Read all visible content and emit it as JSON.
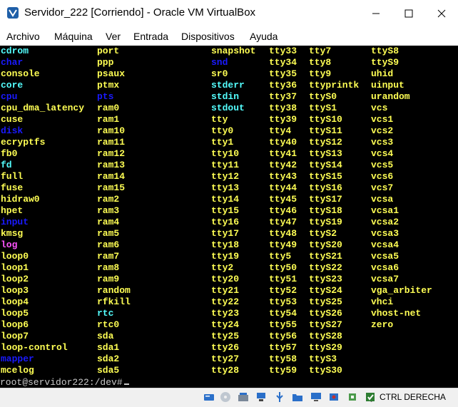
{
  "window": {
    "title": "Servidor_222 [Corriendo] - Oracle VM VirtualBox",
    "icons": [
      "virtualbox-icon",
      "minimize-icon",
      "maximize-icon",
      "close-icon"
    ]
  },
  "menu": [
    "Archivo",
    "Máquina",
    "Ver",
    "Entrada",
    "Dispositivos",
    "Ayuda"
  ],
  "colors": {
    "yellow": "#ffff54",
    "cyan": "#54ffff",
    "blue": "#1a1aff",
    "magenta": "#ff54ff"
  },
  "console": {
    "columns": [
      [
        {
          "t": "cdrom",
          "c": "cyan"
        },
        {
          "t": "char",
          "c": "blue"
        },
        {
          "t": "console",
          "c": "yellow"
        },
        {
          "t": "core",
          "c": "cyan"
        },
        {
          "t": "cpu",
          "c": "blue"
        },
        {
          "t": "cpu_dma_latency",
          "c": "yellow"
        },
        {
          "t": "cuse",
          "c": "yellow"
        },
        {
          "t": "disk",
          "c": "blue"
        },
        {
          "t": "ecryptfs",
          "c": "yellow"
        },
        {
          "t": "fb0",
          "c": "yellow"
        },
        {
          "t": "fd",
          "c": "cyan"
        },
        {
          "t": "full",
          "c": "yellow"
        },
        {
          "t": "fuse",
          "c": "yellow"
        },
        {
          "t": "hidraw0",
          "c": "yellow"
        },
        {
          "t": "hpet",
          "c": "yellow"
        },
        {
          "t": "input",
          "c": "blue"
        },
        {
          "t": "kmsg",
          "c": "yellow"
        },
        {
          "t": "log",
          "c": "magenta"
        },
        {
          "t": "loop0",
          "c": "yellow"
        },
        {
          "t": "loop1",
          "c": "yellow"
        },
        {
          "t": "loop2",
          "c": "yellow"
        },
        {
          "t": "loop3",
          "c": "yellow"
        },
        {
          "t": "loop4",
          "c": "yellow"
        },
        {
          "t": "loop5",
          "c": "yellow"
        },
        {
          "t": "loop6",
          "c": "yellow"
        },
        {
          "t": "loop7",
          "c": "yellow"
        },
        {
          "t": "loop-control",
          "c": "yellow"
        },
        {
          "t": "mapper",
          "c": "blue"
        },
        {
          "t": "mcelog",
          "c": "yellow"
        }
      ],
      [
        {
          "t": "port",
          "c": "yellow"
        },
        {
          "t": "ppp",
          "c": "yellow"
        },
        {
          "t": "psaux",
          "c": "yellow"
        },
        {
          "t": "ptmx",
          "c": "yellow"
        },
        {
          "t": "pts",
          "c": "blue"
        },
        {
          "t": "ram0",
          "c": "yellow"
        },
        {
          "t": "ram1",
          "c": "yellow"
        },
        {
          "t": "ram10",
          "c": "yellow"
        },
        {
          "t": "ram11",
          "c": "yellow"
        },
        {
          "t": "ram12",
          "c": "yellow"
        },
        {
          "t": "ram13",
          "c": "yellow"
        },
        {
          "t": "ram14",
          "c": "yellow"
        },
        {
          "t": "ram15",
          "c": "yellow"
        },
        {
          "t": "ram2",
          "c": "yellow"
        },
        {
          "t": "ram3",
          "c": "yellow"
        },
        {
          "t": "ram4",
          "c": "yellow"
        },
        {
          "t": "ram5",
          "c": "yellow"
        },
        {
          "t": "ram6",
          "c": "yellow"
        },
        {
          "t": "ram7",
          "c": "yellow"
        },
        {
          "t": "ram8",
          "c": "yellow"
        },
        {
          "t": "ram9",
          "c": "yellow"
        },
        {
          "t": "random",
          "c": "yellow"
        },
        {
          "t": "rfkill",
          "c": "yellow"
        },
        {
          "t": "rtc",
          "c": "cyan"
        },
        {
          "t": "rtc0",
          "c": "yellow"
        },
        {
          "t": "sda",
          "c": "yellow"
        },
        {
          "t": "sda1",
          "c": "yellow"
        },
        {
          "t": "sda2",
          "c": "yellow"
        },
        {
          "t": "sda5",
          "c": "yellow"
        }
      ],
      [
        {
          "t": "snapshot",
          "c": "yellow"
        },
        {
          "t": "snd",
          "c": "blue"
        },
        {
          "t": "sr0",
          "c": "yellow"
        },
        {
          "t": "stderr",
          "c": "cyan"
        },
        {
          "t": "stdin",
          "c": "cyan"
        },
        {
          "t": "stdout",
          "c": "cyan"
        },
        {
          "t": "tty",
          "c": "yellow"
        },
        {
          "t": "tty0",
          "c": "yellow"
        },
        {
          "t": "tty1",
          "c": "yellow"
        },
        {
          "t": "tty10",
          "c": "yellow"
        },
        {
          "t": "tty11",
          "c": "yellow"
        },
        {
          "t": "tty12",
          "c": "yellow"
        },
        {
          "t": "tty13",
          "c": "yellow"
        },
        {
          "t": "tty14",
          "c": "yellow"
        },
        {
          "t": "tty15",
          "c": "yellow"
        },
        {
          "t": "tty16",
          "c": "yellow"
        },
        {
          "t": "tty17",
          "c": "yellow"
        },
        {
          "t": "tty18",
          "c": "yellow"
        },
        {
          "t": "tty19",
          "c": "yellow"
        },
        {
          "t": "tty2",
          "c": "yellow"
        },
        {
          "t": "tty20",
          "c": "yellow"
        },
        {
          "t": "tty21",
          "c": "yellow"
        },
        {
          "t": "tty22",
          "c": "yellow"
        },
        {
          "t": "tty23",
          "c": "yellow"
        },
        {
          "t": "tty24",
          "c": "yellow"
        },
        {
          "t": "tty25",
          "c": "yellow"
        },
        {
          "t": "tty26",
          "c": "yellow"
        },
        {
          "t": "tty27",
          "c": "yellow"
        },
        {
          "t": "tty28",
          "c": "yellow"
        }
      ],
      [
        {
          "t": "tty33",
          "c": "yellow"
        },
        {
          "t": "tty34",
          "c": "yellow"
        },
        {
          "t": "tty35",
          "c": "yellow"
        },
        {
          "t": "tty36",
          "c": "yellow"
        },
        {
          "t": "tty37",
          "c": "yellow"
        },
        {
          "t": "tty38",
          "c": "yellow"
        },
        {
          "t": "tty39",
          "c": "yellow"
        },
        {
          "t": "tty4",
          "c": "yellow"
        },
        {
          "t": "tty40",
          "c": "yellow"
        },
        {
          "t": "tty41",
          "c": "yellow"
        },
        {
          "t": "tty42",
          "c": "yellow"
        },
        {
          "t": "tty43",
          "c": "yellow"
        },
        {
          "t": "tty44",
          "c": "yellow"
        },
        {
          "t": "tty45",
          "c": "yellow"
        },
        {
          "t": "tty46",
          "c": "yellow"
        },
        {
          "t": "tty47",
          "c": "yellow"
        },
        {
          "t": "tty48",
          "c": "yellow"
        },
        {
          "t": "tty49",
          "c": "yellow"
        },
        {
          "t": "tty5",
          "c": "yellow"
        },
        {
          "t": "tty50",
          "c": "yellow"
        },
        {
          "t": "tty51",
          "c": "yellow"
        },
        {
          "t": "tty52",
          "c": "yellow"
        },
        {
          "t": "tty53",
          "c": "yellow"
        },
        {
          "t": "tty54",
          "c": "yellow"
        },
        {
          "t": "tty55",
          "c": "yellow"
        },
        {
          "t": "tty56",
          "c": "yellow"
        },
        {
          "t": "tty57",
          "c": "yellow"
        },
        {
          "t": "tty58",
          "c": "yellow"
        },
        {
          "t": "tty59",
          "c": "yellow"
        }
      ],
      [
        {
          "t": "tty7",
          "c": "yellow"
        },
        {
          "t": "tty8",
          "c": "yellow"
        },
        {
          "t": "tty9",
          "c": "yellow"
        },
        {
          "t": "ttyprintk",
          "c": "yellow"
        },
        {
          "t": "ttyS0",
          "c": "yellow"
        },
        {
          "t": "ttyS1",
          "c": "yellow"
        },
        {
          "t": "ttyS10",
          "c": "yellow"
        },
        {
          "t": "ttyS11",
          "c": "yellow"
        },
        {
          "t": "ttyS12",
          "c": "yellow"
        },
        {
          "t": "ttyS13",
          "c": "yellow"
        },
        {
          "t": "ttyS14",
          "c": "yellow"
        },
        {
          "t": "ttyS15",
          "c": "yellow"
        },
        {
          "t": "ttyS16",
          "c": "yellow"
        },
        {
          "t": "ttyS17",
          "c": "yellow"
        },
        {
          "t": "ttyS18",
          "c": "yellow"
        },
        {
          "t": "ttyS19",
          "c": "yellow"
        },
        {
          "t": "ttyS2",
          "c": "yellow"
        },
        {
          "t": "ttyS20",
          "c": "yellow"
        },
        {
          "t": "ttyS21",
          "c": "yellow"
        },
        {
          "t": "ttyS22",
          "c": "yellow"
        },
        {
          "t": "ttyS23",
          "c": "yellow"
        },
        {
          "t": "ttyS24",
          "c": "yellow"
        },
        {
          "t": "ttyS25",
          "c": "yellow"
        },
        {
          "t": "ttyS26",
          "c": "yellow"
        },
        {
          "t": "ttyS27",
          "c": "yellow"
        },
        {
          "t": "ttyS28",
          "c": "yellow"
        },
        {
          "t": "ttyS29",
          "c": "yellow"
        },
        {
          "t": "ttyS3",
          "c": "yellow"
        },
        {
          "t": "ttyS30",
          "c": "yellow"
        }
      ],
      [
        {
          "t": "ttyS8",
          "c": "yellow"
        },
        {
          "t": "ttyS9",
          "c": "yellow"
        },
        {
          "t": "uhid",
          "c": "yellow"
        },
        {
          "t": "uinput",
          "c": "yellow"
        },
        {
          "t": "urandom",
          "c": "yellow"
        },
        {
          "t": "vcs",
          "c": "yellow"
        },
        {
          "t": "vcs1",
          "c": "yellow"
        },
        {
          "t": "vcs2",
          "c": "yellow"
        },
        {
          "t": "vcs3",
          "c": "yellow"
        },
        {
          "t": "vcs4",
          "c": "yellow"
        },
        {
          "t": "vcs5",
          "c": "yellow"
        },
        {
          "t": "vcs6",
          "c": "yellow"
        },
        {
          "t": "vcs7",
          "c": "yellow"
        },
        {
          "t": "vcsa",
          "c": "yellow"
        },
        {
          "t": "vcsa1",
          "c": "yellow"
        },
        {
          "t": "vcsa2",
          "c": "yellow"
        },
        {
          "t": "vcsa3",
          "c": "yellow"
        },
        {
          "t": "vcsa4",
          "c": "yellow"
        },
        {
          "t": "vcsa5",
          "c": "yellow"
        },
        {
          "t": "vcsa6",
          "c": "yellow"
        },
        {
          "t": "vcsa7",
          "c": "yellow"
        },
        {
          "t": "vga_arbiter",
          "c": "yellow"
        },
        {
          "t": "vhci",
          "c": "yellow"
        },
        {
          "t": "vhost-net",
          "c": "yellow"
        },
        {
          "t": "zero",
          "c": "yellow"
        }
      ]
    ],
    "prompt": "root@servidor222:/dev#"
  },
  "status": {
    "icons": [
      "hard-disk-icon",
      "optical-drive-icon",
      "audio-icon",
      "network-icon",
      "usb-icon",
      "shared-folders-icon",
      "display-icon",
      "video-capture-icon",
      "cpu-icon",
      "mouse-integration-icon",
      "keyboard-capture-icon"
    ],
    "host_key": "CTRL DERECHA"
  }
}
